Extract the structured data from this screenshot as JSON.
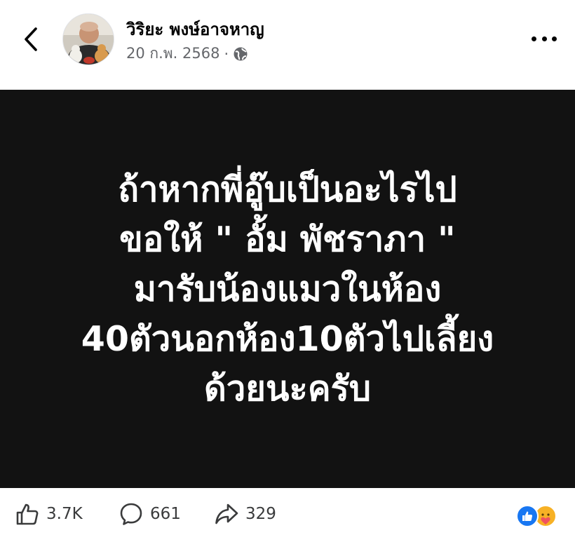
{
  "header": {
    "author_name": "วิริยะ พงษ์อาจหาญ",
    "date": "20 ก.พ. 2568",
    "separator": "·"
  },
  "post": {
    "text_lines": [
      "ถ้าหากพี่อู๊บเป็นอะไรไป",
      "ขอให้ \" อั้ม พัชราภา \"",
      "มารับน้องแมวในห้อง",
      "40ตัวนอกห้อง10ตัวไปเลี้ยง",
      "ด้วยนะครับ"
    ]
  },
  "actions": {
    "likes": "3.7K",
    "comments": "661",
    "shares": "329"
  },
  "colors": {
    "image_bg": "#121212",
    "like_blue": "#1877f2",
    "care_yellow": "#f7b125"
  }
}
